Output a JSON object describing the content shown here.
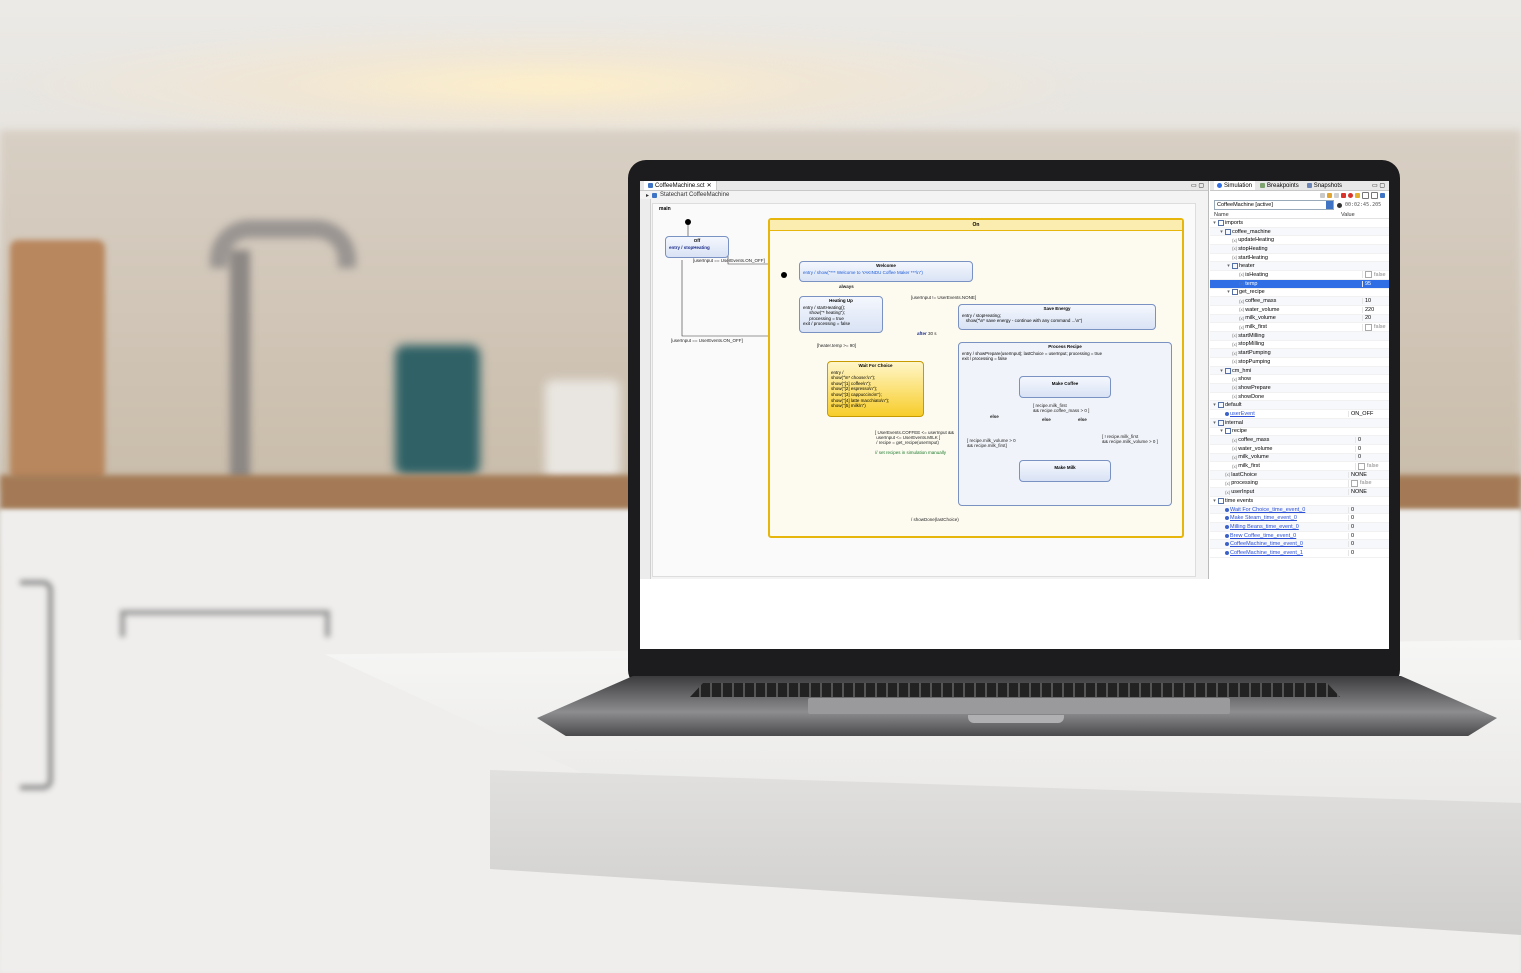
{
  "editor": {
    "tab_title": "CoffeeMachine.sct",
    "breadcrumb": "Statechart CoffeeMachine",
    "region_label": "main",
    "states": {
      "off": {
        "name": "Off",
        "body": "entry / stopHeating"
      },
      "on": {
        "name": "On"
      },
      "welcome": {
        "name": "Welcome",
        "body": "entry / show(\"*** Welcome to YAKINDU Coffee Maker ***\\n\")"
      },
      "heating_up": {
        "name": "Heating Up",
        "body": "entry / startHeating();\n     show(\"* heating\");\n     processing = true\nexit / processing = false"
      },
      "save_energy": {
        "name": "Save Energy",
        "body": "entry / stopHeating;\n   show(\"\\n* save energy - continue with any command ...\\n\")"
      },
      "wait_for_choice": {
        "name": "Wait For Choice",
        "body": "entry /\nshow(\"\\n* choose:\\n\");\nshow(\"[1] coffee\\n\");\nshow(\"[2] espresso\\n\");\nshow(\"[3] cappuccino\\n\");\nshow(\"[4] latte macchiato\\n\");\nshow(\"[5] milk\\n\")"
      },
      "process_recipe": {
        "name": "Process Recipe",
        "body": "entry / showPrepare(userInput); lastChoice = userInput; processing = true\nexit / processing = false"
      },
      "make_coffee": {
        "name": "Make Coffee"
      },
      "make_milk": {
        "name": "Make Milk"
      }
    },
    "transitions": {
      "on_off_1": "[userInput == UserEvents.ON_OFF]",
      "on_off_2": "[userInput == UserEvents.ON_OFF]",
      "always": "always",
      "not_none": "[userInput != UserEvents.NONE]",
      "after": "after",
      "after_unit": "30 s",
      "heater_temp": "[heater.temp >= 90]",
      "choice": "[ UserEvents.COFFEE <= userInput &&\n userInput <= UserEvents.MILK ]\n / recipe = get_recipe(userInput)",
      "choice_comment": "// set recipes in simulation manually",
      "milk_first": "[ recipe.milk_first\n&& recipe.coffee_mass > 0 ]",
      "milk_volume_a": "[ recipe.milk_volume > 0\n&& recipe.milk_first]",
      "milk_volume_b": "[ ! recipe.milk_first\n&& recipe.milk_volume > 0 ]",
      "else_1": "else",
      "else_2": "else",
      "else_3": "else",
      "show_done": "/ showDone(lastChoice)"
    }
  },
  "simulation": {
    "tabs": [
      "Simulation",
      "Breakpoints",
      "Snapshots"
    ],
    "session": "CoffeeMachine [active]",
    "clock": "00:02:45.205",
    "col_name": "Name",
    "col_value": "Value",
    "rows": [
      {
        "indent": 0,
        "tw": "▾",
        "kind": "pkg",
        "name": "imports",
        "value": ""
      },
      {
        "indent": 1,
        "tw": "▾",
        "kind": "pkg",
        "name": "coffee_machine",
        "value": ""
      },
      {
        "indent": 2,
        "tw": "",
        "kind": "fn",
        "name": "updateHeating",
        "value": ""
      },
      {
        "indent": 2,
        "tw": "",
        "kind": "fn",
        "name": "stopHeating",
        "value": ""
      },
      {
        "indent": 2,
        "tw": "",
        "kind": "fn",
        "name": "startHeating",
        "value": ""
      },
      {
        "indent": 2,
        "tw": "▾",
        "kind": "pkg",
        "name": "heater",
        "value": ""
      },
      {
        "indent": 3,
        "tw": "",
        "kind": "fn",
        "name": "isHeating",
        "value": "false",
        "check": true
      },
      {
        "indent": 3,
        "tw": "",
        "kind": "fn",
        "name": "temp",
        "value": "95",
        "selected": true
      },
      {
        "indent": 2,
        "tw": "▾",
        "kind": "pkg",
        "name": "get_recipe",
        "value": ""
      },
      {
        "indent": 3,
        "tw": "",
        "kind": "fn",
        "name": "coffee_mass",
        "value": "10"
      },
      {
        "indent": 3,
        "tw": "",
        "kind": "fn",
        "name": "water_volume",
        "value": "220"
      },
      {
        "indent": 3,
        "tw": "",
        "kind": "fn",
        "name": "milk_volume",
        "value": "20"
      },
      {
        "indent": 3,
        "tw": "",
        "kind": "fn",
        "name": "milk_first",
        "value": "false",
        "check": true
      },
      {
        "indent": 2,
        "tw": "",
        "kind": "fn",
        "name": "startMilling",
        "value": ""
      },
      {
        "indent": 2,
        "tw": "",
        "kind": "fn",
        "name": "stopMilling",
        "value": ""
      },
      {
        "indent": 2,
        "tw": "",
        "kind": "fn",
        "name": "startPumping",
        "value": ""
      },
      {
        "indent": 2,
        "tw": "",
        "kind": "fn",
        "name": "stopPumping",
        "value": ""
      },
      {
        "indent": 1,
        "tw": "▾",
        "kind": "pkg",
        "name": "cm_hmi",
        "value": ""
      },
      {
        "indent": 2,
        "tw": "",
        "kind": "fn",
        "name": "show",
        "value": ""
      },
      {
        "indent": 2,
        "tw": "",
        "kind": "fn",
        "name": "showPrepare",
        "value": ""
      },
      {
        "indent": 2,
        "tw": "",
        "kind": "fn",
        "name": "showDone",
        "value": ""
      },
      {
        "indent": 0,
        "tw": "▾",
        "kind": "pkg",
        "name": "default",
        "value": ""
      },
      {
        "indent": 1,
        "tw": "",
        "kind": "link",
        "name": "userEvent",
        "value": "ON_OFF"
      },
      {
        "indent": 0,
        "tw": "▾",
        "kind": "pkg",
        "name": "internal",
        "value": ""
      },
      {
        "indent": 1,
        "tw": "▾",
        "kind": "pkg",
        "name": "recipe",
        "value": ""
      },
      {
        "indent": 2,
        "tw": "",
        "kind": "fn",
        "name": "coffee_mass",
        "value": "0"
      },
      {
        "indent": 2,
        "tw": "",
        "kind": "fn",
        "name": "water_volume",
        "value": "0"
      },
      {
        "indent": 2,
        "tw": "",
        "kind": "fn",
        "name": "milk_volume",
        "value": "0"
      },
      {
        "indent": 2,
        "tw": "",
        "kind": "fn",
        "name": "milk_first",
        "value": "false",
        "check": true
      },
      {
        "indent": 1,
        "tw": "",
        "kind": "fn",
        "name": "lastChoice",
        "value": "NONE"
      },
      {
        "indent": 1,
        "tw": "",
        "kind": "fn",
        "name": "processing",
        "value": "false",
        "check": true
      },
      {
        "indent": 1,
        "tw": "",
        "kind": "fn",
        "name": "userInput",
        "value": "NONE"
      },
      {
        "indent": 0,
        "tw": "▾",
        "kind": "pkg",
        "name": "time events",
        "value": ""
      },
      {
        "indent": 1,
        "tw": "",
        "kind": "ev",
        "name": "Wait For Choice_time_event_0",
        "value": "0"
      },
      {
        "indent": 1,
        "tw": "",
        "kind": "ev",
        "name": "Make Steam_time_event_0",
        "value": "0"
      },
      {
        "indent": 1,
        "tw": "",
        "kind": "ev",
        "name": "Milling Beans_time_event_0",
        "value": "0"
      },
      {
        "indent": 1,
        "tw": "",
        "kind": "ev",
        "name": "Brew Coffee_time_event_0",
        "value": "0"
      },
      {
        "indent": 1,
        "tw": "",
        "kind": "ev",
        "name": "CoffeeMachine_time_event_0",
        "value": "0"
      },
      {
        "indent": 1,
        "tw": "",
        "kind": "ev",
        "name": "CoffeeMachine_time_event_1",
        "value": "0"
      }
    ]
  },
  "colors": {
    "accent": "#2f6ee5",
    "state_yellow": "#f7cd2a",
    "region_border": "#e7b60c"
  }
}
